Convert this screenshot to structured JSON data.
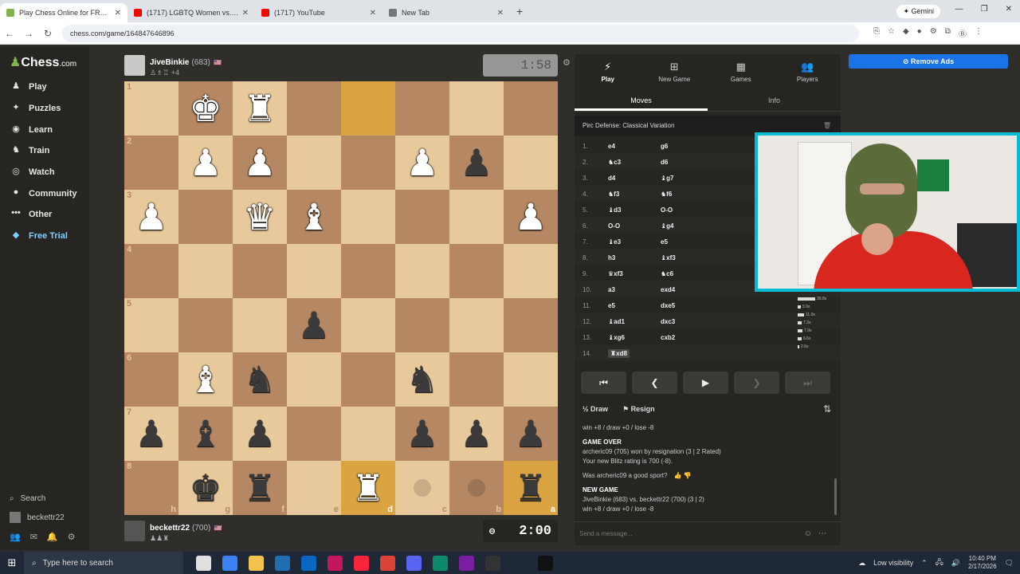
{
  "browser": {
    "tabs": [
      {
        "label": "Play Chess Online for FREE - 2 Million...",
        "color": "#81b64c",
        "active": true
      },
      {
        "label": "(1717) LGBTQ Women vs. Former...",
        "color": "#ff0000",
        "active": false
      },
      {
        "label": "(1717) YouTube",
        "color": "#ff0000",
        "active": false
      },
      {
        "label": "New Tab",
        "color": "#777777",
        "active": false
      }
    ],
    "gemini_label": "Gemini",
    "url": "chess.com/game/164847646896"
  },
  "sidebar": {
    "logo": "Chess",
    "logo_suffix": ".com",
    "items": [
      {
        "label": "Play",
        "icon": "play-icon",
        "glyph": "♟"
      },
      {
        "label": "Puzzles",
        "icon": "puzzles-icon",
        "glyph": "✦"
      },
      {
        "label": "Learn",
        "icon": "learn-icon",
        "glyph": "◉"
      },
      {
        "label": "Train",
        "icon": "train-icon",
        "glyph": "♞"
      },
      {
        "label": "Watch",
        "icon": "watch-icon",
        "glyph": "◎"
      },
      {
        "label": "Community",
        "icon": "community-icon",
        "glyph": "●"
      },
      {
        "label": "Other",
        "icon": "more-icon",
        "glyph": "•••"
      },
      {
        "label": "Free Trial",
        "icon": "diamond-icon",
        "glyph": "◆"
      }
    ],
    "search_label": "Search",
    "username": "beckettr22"
  },
  "top_player": {
    "name": "JiveBinkie",
    "rating": "(683)",
    "captured": "+4",
    "clock": "1:58"
  },
  "bottom_player": {
    "name": "beckettr22",
    "rating": "(700)",
    "clock": "2:00"
  },
  "board": {
    "rank_labels": [
      "1",
      "2",
      "3",
      "4",
      "5",
      "6",
      "7",
      "8"
    ],
    "file_labels": [
      "h",
      "g",
      "f",
      "e",
      "d",
      "c",
      "b",
      "a"
    ],
    "rows": [
      [
        "",
        "wK",
        "wR",
        "",
        "",
        "",
        "",
        ""
      ],
      [
        "",
        "wP",
        "wP",
        "",
        "",
        "wP",
        "bP",
        ""
      ],
      [
        "wP",
        "",
        "wQ",
        "wB",
        "",
        "",
        "",
        "wP"
      ],
      [
        "",
        "",
        "",
        "",
        "",
        "",
        "",
        ""
      ],
      [
        "",
        "",
        "",
        "bP",
        "",
        "",
        "",
        ""
      ],
      [
        "",
        "wB",
        "bN",
        "",
        "",
        "bN",
        "",
        ""
      ],
      [
        "bP",
        "bB",
        "bP",
        "",
        "",
        "bP",
        "bP",
        "bP"
      ],
      [
        "",
        "bK",
        "bR",
        "",
        "wR",
        "",
        "",
        "bR"
      ]
    ],
    "highlight_squares": [
      "0-4",
      "7-4",
      "7-7"
    ],
    "hint_squares": [
      "7-5",
      "7-6"
    ]
  },
  "panel": {
    "tabs": [
      {
        "label": "Play",
        "icon": "lightning-icon",
        "glyph": "⚡"
      },
      {
        "label": "New Game",
        "icon": "plus-icon",
        "glyph": "⊞"
      },
      {
        "label": "Games",
        "icon": "grid-icon",
        "glyph": "▦"
      },
      {
        "label": "Players",
        "icon": "players-icon",
        "glyph": "👥"
      }
    ],
    "subtabs": [
      "Moves",
      "Info"
    ],
    "opening": "Pirc Defense: Classical Variation",
    "moves": [
      {
        "n": "1.",
        "w": "e4",
        "b": "g6"
      },
      {
        "n": "2.",
        "w": "♞c3",
        "b": "d6"
      },
      {
        "n": "3.",
        "w": "d4",
        "b": "♝g7"
      },
      {
        "n": "4.",
        "w": "♞f3",
        "b": "♞f6"
      },
      {
        "n": "5.",
        "w": "♝d3",
        "b": "O-O"
      },
      {
        "n": "6.",
        "w": "O-O",
        "b": "♝g4"
      },
      {
        "n": "7.",
        "w": "♝e3",
        "b": "e5"
      },
      {
        "n": "8.",
        "w": "h3",
        "b": "♝xf3"
      },
      {
        "n": "9.",
        "w": "♛xf3",
        "b": "♞c6"
      },
      {
        "n": "10.",
        "w": "a3",
        "b": "exd4"
      },
      {
        "n": "11.",
        "w": "e5",
        "b": "dxe5"
      },
      {
        "n": "12.",
        "w": "♝ad1",
        "b": "dxc3"
      },
      {
        "n": "13.",
        "w": "♝xg6",
        "b": "cxb2"
      },
      {
        "n": "14.",
        "w": "♜xd8",
        "b": ""
      }
    ],
    "time_bars": [
      {
        "label": "30.8s",
        "fill": 1.0
      },
      {
        "label": "5.9s",
        "fill": 0.2
      },
      {
        "label": "11.0s",
        "fill": 0.36
      },
      {
        "label": "7.3s",
        "fill": 0.24
      },
      {
        "label": "7.9s",
        "fill": 0.26
      },
      {
        "label": "6.6s",
        "fill": 0.21
      },
      {
        "label": "2.6s",
        "fill": 0.08
      }
    ],
    "draw_label": "Draw",
    "resign_label": "Resign",
    "chat": {
      "line0": "win +8 / draw +0 / lose -8",
      "game_over": "GAME OVER",
      "result": "archeric09 (705) won by resignation (3 | 2 Rated)",
      "rating": "Your new Blitz rating is 700 (-8).",
      "sport": "Was archeric09 a good sport?",
      "new_game": "NEW GAME",
      "matchup": "JiveBinkie (683) vs. beckettr22 (700) (3 | 2)",
      "line_last": "win +8 / draw +0 / lose -8"
    },
    "message_placeholder": "Send a message..."
  },
  "remove_ads": "Remove Ads",
  "taskbar": {
    "search_placeholder": "Type here to search",
    "visibility": "Low visibility",
    "time": "10:40 PM",
    "date": "2/17/2026",
    "apps": [
      "#e0e0e0",
      "#3b82f6",
      "#f2c14e",
      "#1f6fb2",
      "#0a66c2",
      "#c2185b",
      "#fa243c",
      "#db4437",
      "#5865f2",
      "#0c8a6b",
      "#7b1fa2",
      "#333333",
      "#1b2838",
      "#111111"
    ]
  }
}
